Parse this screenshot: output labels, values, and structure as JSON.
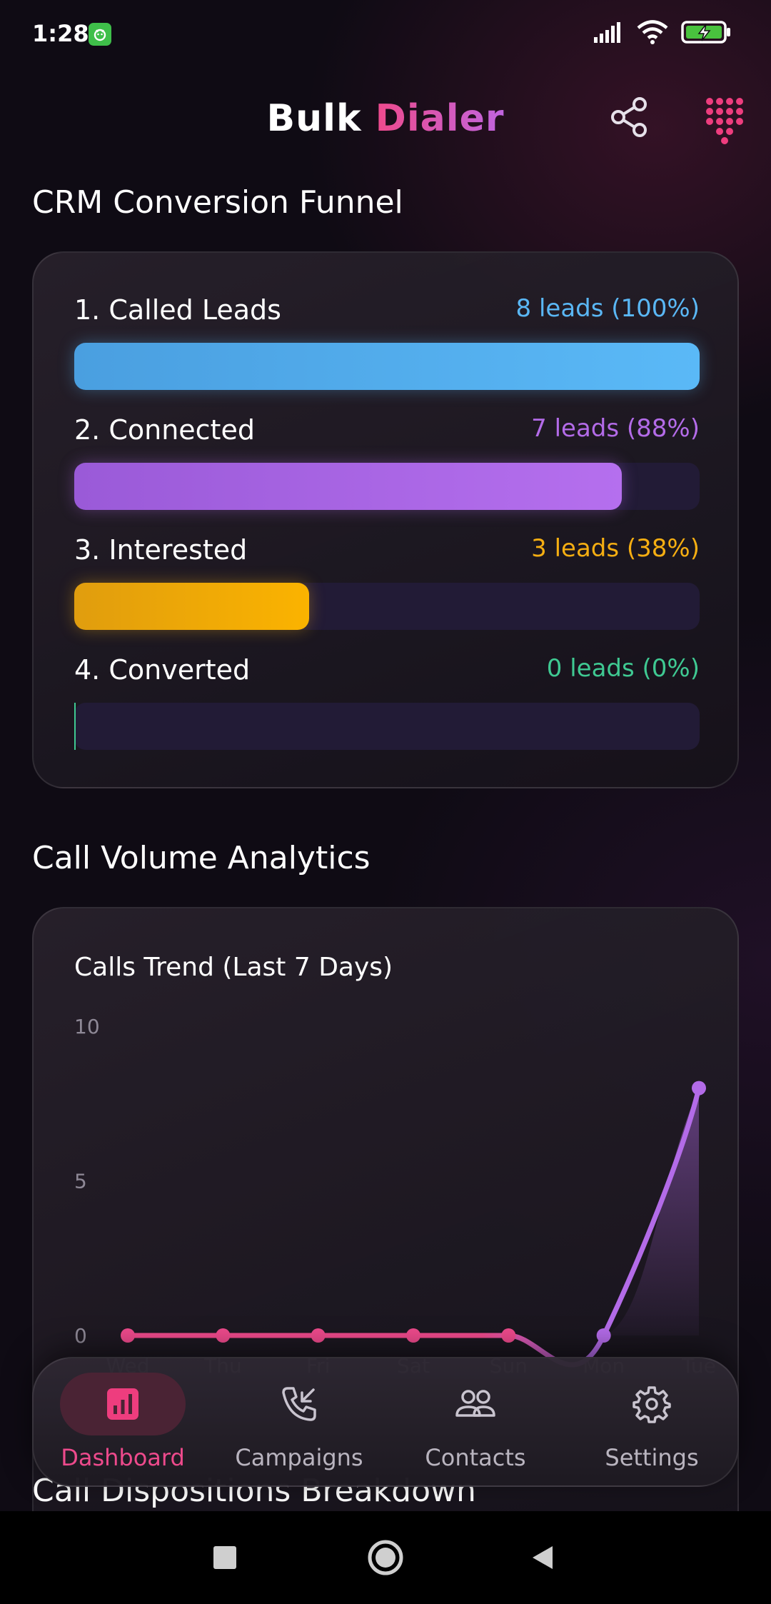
{
  "status_bar": {
    "time": "1:28"
  },
  "header": {
    "title_part1": "Bulk",
    "title_part2": "Dialer"
  },
  "funnel": {
    "section_title": "CRM Conversion Funnel",
    "stages": [
      {
        "label": "1. Called Leads",
        "count_text": "8 leads (100%)",
        "fraction": 1.0,
        "color": "#5ab7f5"
      },
      {
        "label": "2. Connected",
        "count_text": "7 leads (88%)",
        "fraction": 0.875,
        "color": "#b36be8"
      },
      {
        "label": "3. Interested",
        "count_text": "3 leads (38%)",
        "fraction": 0.375,
        "color": "#f5ae12"
      },
      {
        "label": "4. Converted",
        "count_text": "0 leads (0%)",
        "fraction": 0.0,
        "color": "#3fc992"
      }
    ]
  },
  "analytics": {
    "section_title": "Call Volume Analytics"
  },
  "chart_data": {
    "type": "line",
    "title": "Calls Trend (Last 7 Days)",
    "x": [
      "Wed",
      "Thu",
      "Fri",
      "Sat",
      "Sun",
      "Mon",
      "Tue"
    ],
    "values": [
      0,
      0,
      0,
      0,
      0,
      0,
      8
    ],
    "ylim": [
      0,
      10
    ],
    "yticks": [
      "10",
      "5",
      "0"
    ],
    "grid": false,
    "line_color_start": "#ee4a8c",
    "line_color_end": "#b36be8"
  },
  "bottom_nav": {
    "items": [
      {
        "label": "Dashboard",
        "icon": "chart-bar-icon",
        "active": true
      },
      {
        "label": "Campaigns",
        "icon": "phone-incoming-icon",
        "active": false
      },
      {
        "label": "Contacts",
        "icon": "people-icon",
        "active": false
      },
      {
        "label": "Settings",
        "icon": "gear-icon",
        "active": false
      }
    ]
  },
  "next_section": {
    "title": "Call Dispositions Breakdown"
  }
}
